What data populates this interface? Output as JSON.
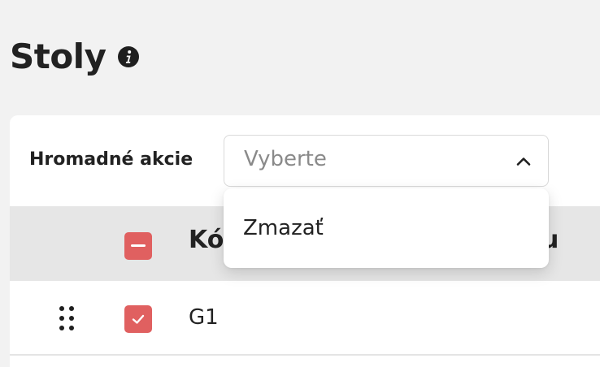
{
  "page": {
    "title": "Stoly"
  },
  "bulk_actions": {
    "label": "Hromadné akcie",
    "select_value": "Vyberte",
    "options": [
      "Zmazať"
    ]
  },
  "table": {
    "columns": [
      "Kód",
      "u"
    ],
    "rows": [
      {
        "code": "G1",
        "checked": true
      }
    ]
  },
  "icons": {
    "title": "info-icon",
    "select": "chevron-up-icon",
    "row_handle": "drag-handle-icon",
    "row_check": "check-icon"
  },
  "colors": {
    "accent": "#e06060",
    "background": "#f2f2f2",
    "header_bg": "#e6e6e6"
  }
}
